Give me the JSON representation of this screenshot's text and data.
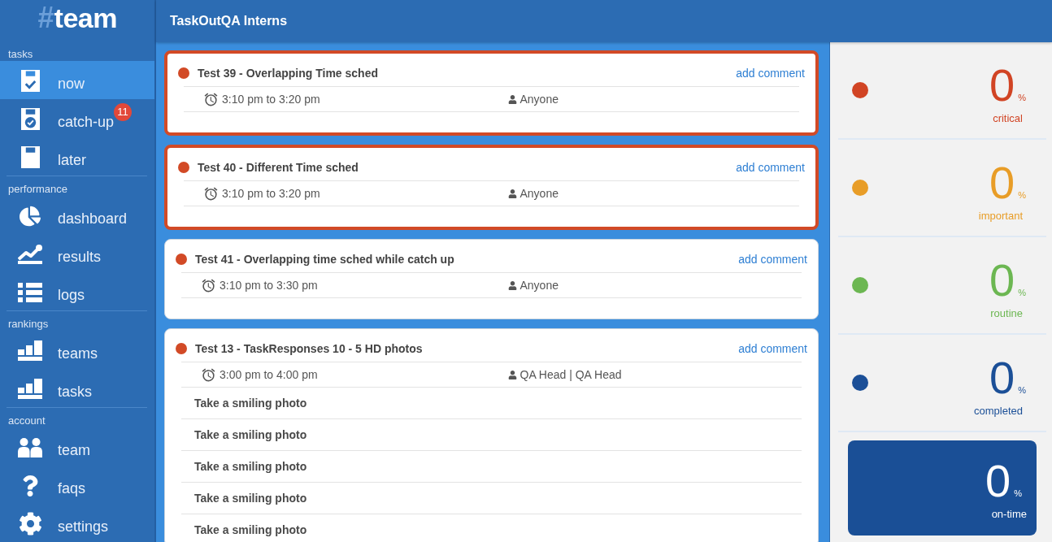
{
  "logo": {
    "mark": "#",
    "text": "team"
  },
  "sidebar": {
    "sections": [
      {
        "title": "tasks",
        "items": [
          {
            "label": "now",
            "selected": true
          },
          {
            "label": "catch-up",
            "selected": false,
            "badge": "11"
          },
          {
            "label": "later",
            "selected": false
          }
        ]
      },
      {
        "title": "performance",
        "items": [
          {
            "label": "dashboard",
            "selected": false
          },
          {
            "label": "results",
            "selected": false
          },
          {
            "label": "logs",
            "selected": false
          }
        ]
      },
      {
        "title": "rankings",
        "items": [
          {
            "label": "teams",
            "selected": false
          },
          {
            "label": "tasks",
            "selected": false
          }
        ]
      },
      {
        "title": "account",
        "items": [
          {
            "label": "team",
            "selected": false
          },
          {
            "label": "faqs",
            "selected": false
          },
          {
            "label": "settings",
            "selected": false
          }
        ]
      }
    ]
  },
  "header": {
    "title": "TaskOutQA Interns"
  },
  "tasks": [
    {
      "title": "Test 39 - Overlapping Time sched",
      "highlighted": true,
      "action": "add comment",
      "time": "3:10 pm to 3:20 pm",
      "assignee": "Anyone"
    },
    {
      "title": "Test 40 - Different Time sched",
      "highlighted": true,
      "action": "add comment",
      "time": "3:10 pm to 3:20 pm",
      "assignee": "Anyone"
    },
    {
      "title": "Test 41 - Overlapping time sched while catch up",
      "highlighted": false,
      "action": "add comment",
      "time": "3:10 pm to 3:30 pm",
      "assignee": "Anyone"
    },
    {
      "title": "Test 13 - TaskResponses 10 - 5 HD photos",
      "highlighted": false,
      "action": "add comment",
      "time": "3:00 pm to 4:00 pm",
      "assignee": "QA Head | QA Head",
      "steps": [
        "Take a smiling photo",
        "Take a smiling photo",
        "Take a smiling photo",
        "Take a smiling photo",
        "Take a smiling photo"
      ]
    }
  ],
  "stats": [
    {
      "value": "0",
      "unit": "%",
      "label": "critical",
      "color": "#d14424"
    },
    {
      "value": "0",
      "unit": "%",
      "label": "important",
      "color": "#e89d27"
    },
    {
      "value": "0",
      "unit": "%",
      "label": "routine",
      "color": "#6cb752"
    },
    {
      "value": "0",
      "unit": "%",
      "label": "completed",
      "color": "#1b4f97"
    }
  ],
  "on_time": {
    "value": "0",
    "unit": "%",
    "label": "on-time"
  }
}
